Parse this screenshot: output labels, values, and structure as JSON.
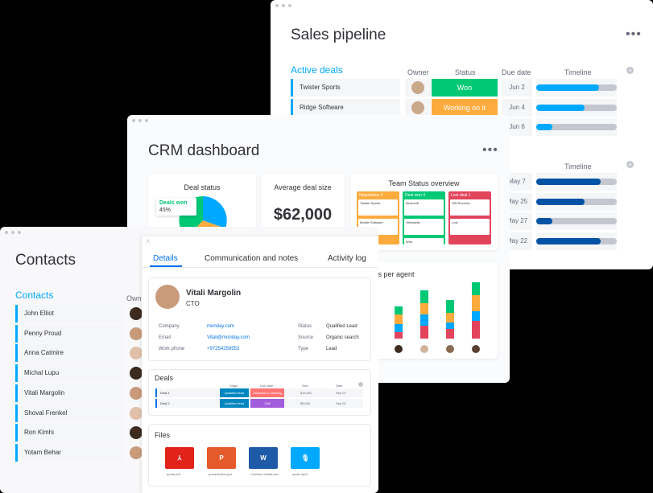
{
  "sales": {
    "title": "Sales pipeline",
    "more": "•••",
    "group1": "Active deals",
    "cols": {
      "owner": "Owner",
      "status": "Status",
      "due": "Due date",
      "timeline": "Timeline",
      "timeline2": "Timeline"
    },
    "rows": [
      {
        "name": "Twister Sports",
        "status": "Won",
        "color": "#00c875",
        "due": "Jun 2",
        "progress": 0.78,
        "barColor": "#00a9ff"
      },
      {
        "name": "Ridge Software",
        "status": "Working on it",
        "color": "#fdab3d",
        "due": "Jun 4",
        "progress": 0.6,
        "barColor": "#00a9ff"
      },
      {
        "name": "",
        "status": "",
        "color": "",
        "due": "Jun 6",
        "progress": 0.2,
        "barColor": "#00a9ff"
      }
    ],
    "rows2": [
      {
        "due": "May 7",
        "progress": 0.8,
        "barColor": "#0052a5"
      },
      {
        "due": "May 25",
        "progress": 0.6,
        "barColor": "#0052a5"
      },
      {
        "due": "May 27",
        "progress": 0.2,
        "barColor": "#0052a5"
      },
      {
        "due": "May 22",
        "progress": 0.8,
        "barColor": "#0052a5"
      }
    ]
  },
  "crm": {
    "title": "CRM dashboard",
    "more": "•••",
    "deal_status": {
      "title": "Deal status",
      "badge": "Deals won",
      "percent": "45%"
    },
    "avg": {
      "title": "Average deal size",
      "value": "$62,000"
    },
    "team": {
      "title": "Team Status overview",
      "cols": [
        {
          "head": "Negotiation 3",
          "color": "#fdab3d",
          "items": [
            "Twister Sports",
            "Mobile Software"
          ]
        },
        {
          "head": "Deal won 4",
          "color": "#00c875",
          "items": [
            "Bluecraft",
            "Yellowelia",
            "Won"
          ]
        },
        {
          "head": "Lost deal 1",
          "color": "#e2445c",
          "items": [
            "ZIR Records",
            "Lost"
          ]
        }
      ]
    },
    "chart_title": "ss per agent"
  },
  "contacts": {
    "title": "Contacts",
    "group": "Contacts",
    "owner_col": "Owne",
    "people": [
      "John Elliot",
      "Penny Proud",
      "Anna Catmire",
      "Michal Lupu",
      "Vitali Margolin",
      "Shoval Frenkel",
      "Ron Kimhi",
      "Yotam Behar"
    ],
    "detail": {
      "close": "×",
      "tabs": [
        "Details",
        "Communication and notes",
        "Activity log"
      ],
      "name": "Vitali Margolin",
      "role": "CTO",
      "fields": [
        {
          "label": "Company",
          "value": "monday.com"
        },
        {
          "label": "Email",
          "value": "Vitali@monday.com"
        },
        {
          "label": "Work phone",
          "value": "+97254256553"
        }
      ],
      "fields2": [
        {
          "label": "Status",
          "value": "Qualified Lead"
        },
        {
          "label": "Source",
          "value": "Organic search"
        },
        {
          "label": "Type",
          "value": "Lead"
        }
      ],
      "deals": {
        "title": "Deals",
        "cols": [
          "Stage",
          "Due date",
          "Size",
          "Date"
        ],
        "rows": [
          {
            "name": "Deal 1",
            "stage": "Qualified lead",
            "due": "Schedule a meeting",
            "size": "$15,800",
            "date": "Sep 07"
          },
          {
            "name": "Deal 2",
            "stage": "Qualified lead",
            "due": "Call",
            "size": "$5,000",
            "date": "Sep 02"
          }
        ]
      },
      "files": {
        "title": "Files",
        "items": [
          {
            "icon": "pdf-icon",
            "glyph": "⅄",
            "color": "#e2231a",
            "name": "quote.pdf"
          },
          {
            "icon": "powerpoint-icon",
            "glyph": "P",
            "color": "#e55a2b",
            "name": "presentation.ppt"
          },
          {
            "icon": "word-icon",
            "glyph": "W",
            "color": "#1e5aa8",
            "name": "Contract details.doc"
          },
          {
            "icon": "microphone-icon",
            "glyph": "🎙",
            "color": "#00a9ff",
            "name": "audio.mp3"
          }
        ]
      }
    }
  }
}
